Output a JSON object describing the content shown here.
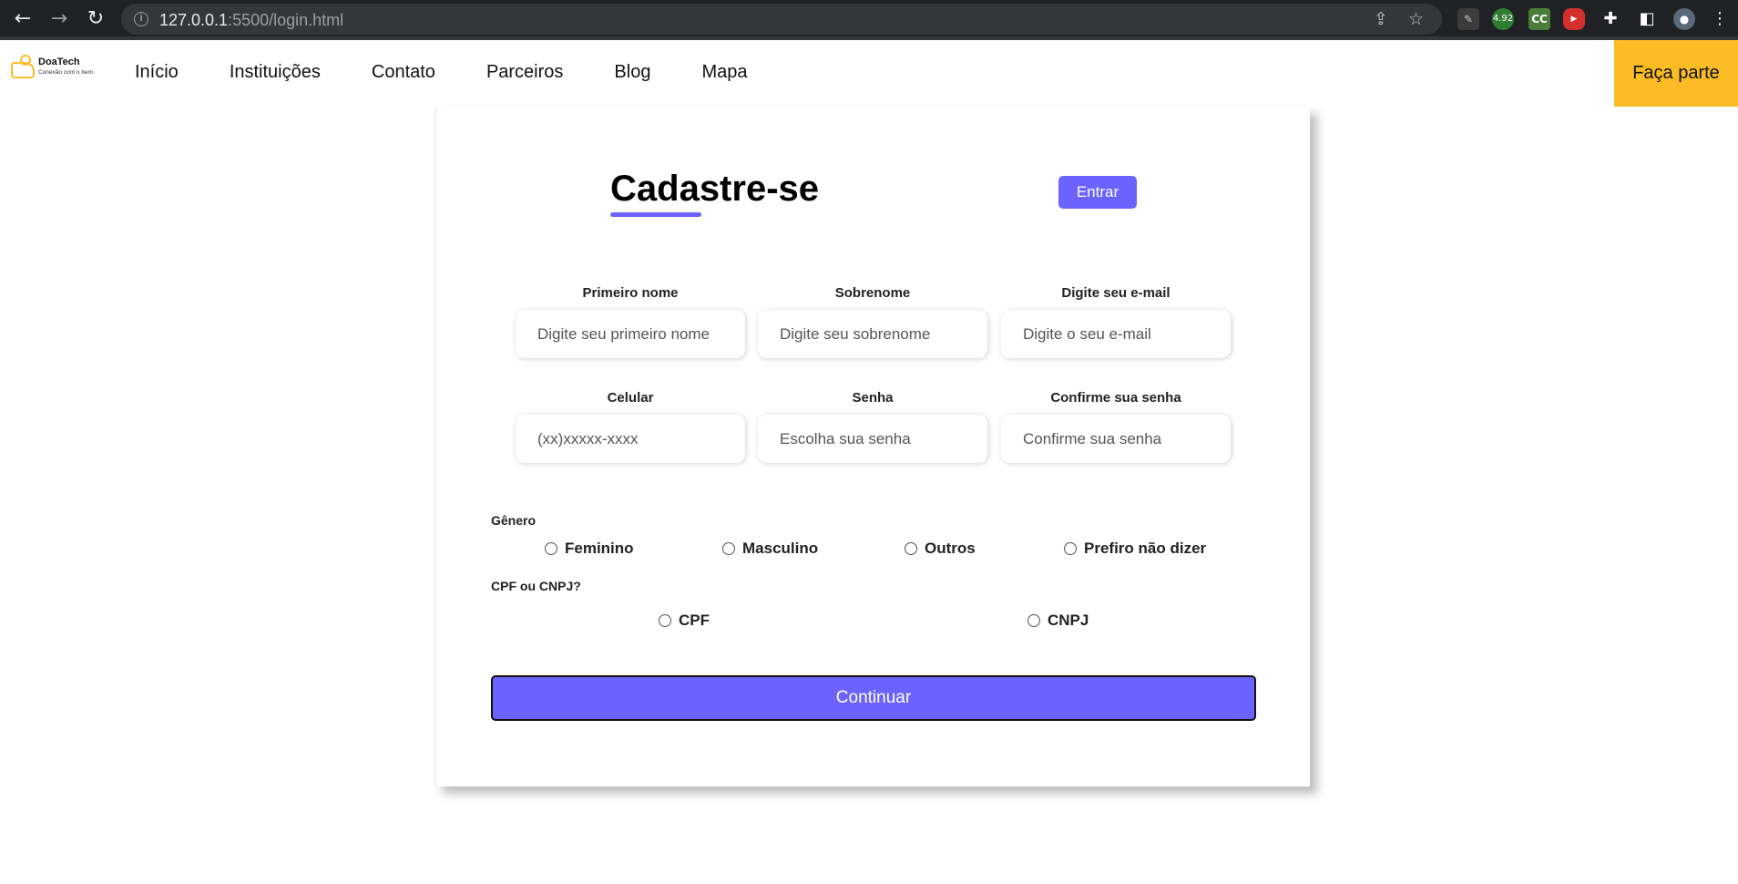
{
  "browser": {
    "url_host": "127.0.0.1",
    "url_path": ":5500/login.html",
    "extension_badge": "4.92"
  },
  "site": {
    "logo_name": "DoaTech",
    "logo_tagline": "Conexão com o bem.",
    "menu": [
      "Início",
      "Instituições",
      "Contato",
      "Parceiros",
      "Blog",
      "Mapa"
    ],
    "cta_label": "Faça parte"
  },
  "form": {
    "title": "Cadastre-se",
    "login_button": "Entrar",
    "fields": [
      {
        "label": "Primeiro nome",
        "placeholder": "Digite seu primeiro nome"
      },
      {
        "label": "Sobrenome",
        "placeholder": "Digite seu sobrenome"
      },
      {
        "label": "Digite seu e-mail",
        "placeholder": "Digite o seu e-mail"
      },
      {
        "label": "Celular",
        "placeholder": "(xx)xxxxx-xxxx"
      },
      {
        "label": "Senha",
        "placeholder": "Escolha sua senha"
      },
      {
        "label": "Confirme sua senha",
        "placeholder": "Confirme sua senha"
      }
    ],
    "gender_label": "Gênero",
    "gender_options": [
      "Feminino",
      "Masculino",
      "Outros",
      "Prefiro não dizer"
    ],
    "doc_label": "CPF ou CNPJ?",
    "doc_options": [
      "CPF",
      "CNPJ"
    ],
    "continue_button": "Continuar"
  },
  "colors": {
    "accent": "#6c63ff",
    "cta": "#fbbc25",
    "chrome": "#202124"
  }
}
